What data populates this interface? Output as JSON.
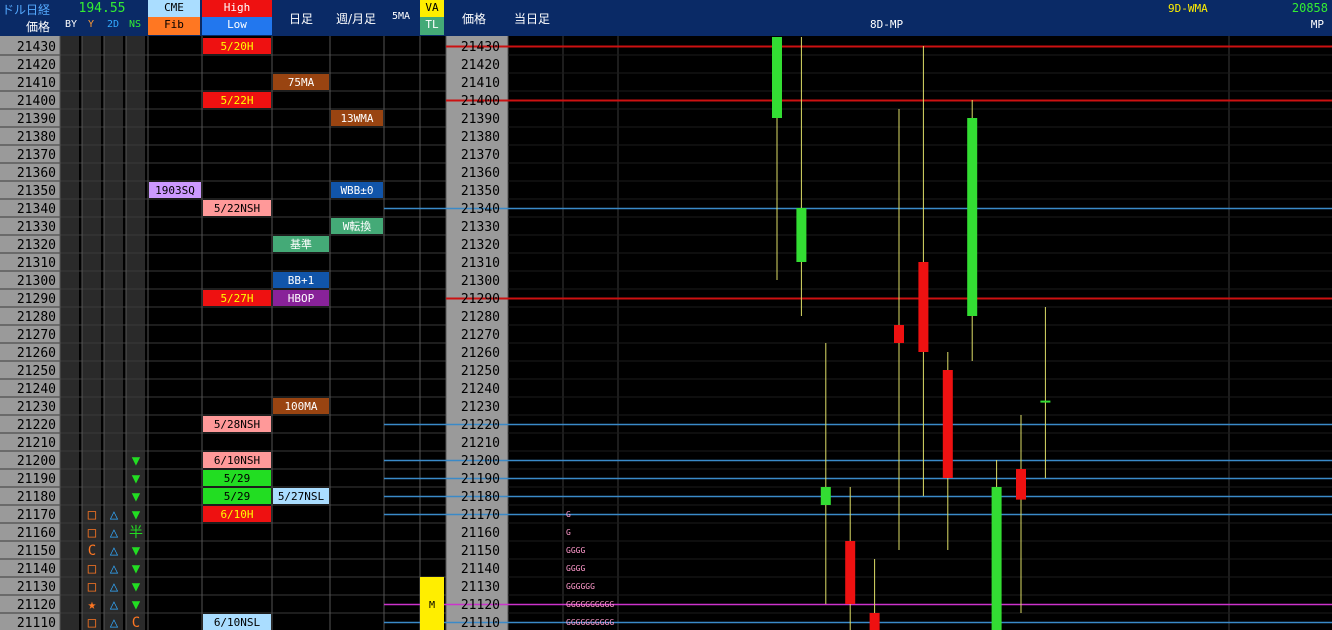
{
  "header": {
    "pair_title": "ドル日経",
    "price_label": "価格",
    "value": "194.55",
    "cme": "CME",
    "fib": "Fib",
    "high": "High",
    "low": "Low",
    "col_by": "BY",
    "col_y": "Y",
    "col_2d": "2D",
    "col_ns": "NS",
    "daily": "日足",
    "weekly_monthly": "週/月足",
    "ma5": "5MA",
    "va": "VA",
    "tl": "TL",
    "price_label2": "価格",
    "today_bar": "当日足",
    "mp8d": "8D-MP",
    "wma9d": "9D-WMA",
    "wma_value": "20858",
    "mp": "MP"
  },
  "colors": {
    "header_bg": "#0a2a66",
    "price_col_bg": "#9a9a9a",
    "up_candle": "#33dd33",
    "down_candle": "#ee1111",
    "red_line": "#cc1111",
    "blue_line": "#3a8ac8",
    "magenta_line": "#cc33cc"
  },
  "chart_data": {
    "type": "candlestick",
    "title": "ドル日経",
    "y_range": [
      21105,
      21435
    ],
    "prices": [
      21430,
      21420,
      21410,
      21400,
      21390,
      21380,
      21370,
      21360,
      21350,
      21340,
      21330,
      21320,
      21310,
      21300,
      21290,
      21280,
      21270,
      21260,
      21250,
      21240,
      21230,
      21220,
      21210,
      21200,
      21190,
      21180,
      21170,
      21160,
      21150,
      21140,
      21130,
      21120,
      21110
    ],
    "candles": [
      {
        "open": 21390,
        "close": 21435,
        "high": 21435,
        "low": 21300
      },
      {
        "open": 21310,
        "close": 21340,
        "high": 21435,
        "low": 21280
      },
      {
        "open": 21175,
        "close": 21185,
        "high": 21265,
        "low": 21120
      },
      {
        "open": 21155,
        "close": 21120,
        "high": 21185,
        "low": 21100
      },
      {
        "open": 21115,
        "close": 21105,
        "high": 21145,
        "low": 21100
      },
      {
        "open": 21275,
        "close": 21265,
        "high": 21395,
        "low": 21150
      },
      {
        "open": 21310,
        "close": 21260,
        "high": 21430,
        "low": 21180
      },
      {
        "open": 21250,
        "close": 21190,
        "high": 21260,
        "low": 21150
      },
      {
        "open": 21280,
        "close": 21390,
        "high": 21400,
        "low": 21255
      },
      {
        "open": 21100,
        "close": 21185,
        "high": 21200,
        "low": 21100
      },
      {
        "open": 21195,
        "close": 21178,
        "high": 21225,
        "low": 21115
      },
      {
        "open": 21233,
        "close": 21233,
        "high": 21285,
        "low": 21190
      }
    ],
    "horizontal_lines": [
      {
        "price": 21430,
        "color": "red"
      },
      {
        "price": 21400,
        "color": "red"
      },
      {
        "price": 21290,
        "color": "red"
      },
      {
        "price": 21340,
        "color": "blue"
      },
      {
        "price": 21220,
        "color": "blue"
      },
      {
        "price": 21200,
        "color": "blue"
      },
      {
        "price": 21190,
        "color": "blue"
      },
      {
        "price": 21180,
        "color": "blue"
      },
      {
        "price": 21170,
        "color": "blue"
      },
      {
        "price": 21120,
        "color": "magenta"
      },
      {
        "price": 21110,
        "color": "blue"
      }
    ],
    "market_profile": [
      {
        "price": 21170,
        "text": "G"
      },
      {
        "price": 21160,
        "text": "G"
      },
      {
        "price": 21150,
        "text": "GGGG"
      },
      {
        "price": 21140,
        "text": "GGGG"
      },
      {
        "price": 21130,
        "text": "GGGGGG"
      },
      {
        "price": 21120,
        "text": "GGGGGGGGGG"
      },
      {
        "price": 21110,
        "text": "GGGGGGGGGG"
      }
    ]
  },
  "cme_labels": [
    {
      "price": 21350,
      "text": "1903SQ",
      "color": "#cc99ff"
    }
  ],
  "highlow_labels": [
    {
      "price": 21430,
      "text": "5/20H",
      "color": "#ee1111",
      "text_color": "#ffff00"
    },
    {
      "price": 21400,
      "text": "5/22H",
      "color": "#ee1111",
      "text_color": "#ffff00"
    },
    {
      "price": 21340,
      "text": "5/22NSH",
      "color": "#ff9999",
      "text_color": "#000"
    },
    {
      "price": 21290,
      "text": "5/27H",
      "color": "#ee1111",
      "text_color": "#ffff00"
    },
    {
      "price": 21220,
      "text": "5/28NSH",
      "color": "#ff9999",
      "text_color": "#000"
    },
    {
      "price": 21200,
      "text": "6/10NSH",
      "color": "#ff9999",
      "text_color": "#000"
    },
    {
      "price": 21190,
      "text": "5/29",
      "color": "#22dd22",
      "text_color": "#000"
    },
    {
      "price": 21180,
      "text": "5/29",
      "color": "#22dd22",
      "text_color": "#000"
    },
    {
      "price": 21170,
      "text": "6/10H",
      "color": "#ee1111",
      "text_color": "#ffff00"
    },
    {
      "price": 21110,
      "text": "6/10NSL",
      "color": "#aaddff",
      "text_color": "#000"
    }
  ],
  "daily_labels": [
    {
      "price": 21410,
      "text": "75MA",
      "color": "#994411",
      "text_color": "#fff"
    },
    {
      "price": 21320,
      "text": "基準",
      "color": "#44aa77",
      "text_color": "#fff"
    },
    {
      "price": 21300,
      "text": "BB+1",
      "color": "#1155aa",
      "text_color": "#fff"
    },
    {
      "price": 21290,
      "text": "HBOP",
      "color": "#882299",
      "text_color": "#fff"
    },
    {
      "price": 21230,
      "text": "100MA",
      "color": "#994411",
      "text_color": "#fff"
    },
    {
      "price": 21180,
      "text": "5/27NSL",
      "color": "#aaddff",
      "text_color": "#000"
    }
  ],
  "weekly_labels": [
    {
      "price": 21390,
      "text": "13WMA",
      "color": "#994411",
      "text_color": "#fff"
    },
    {
      "price": 21350,
      "text": "WBB±0",
      "color": "#1155aa",
      "text_color": "#fff"
    },
    {
      "price": 21330,
      "text": "W転換",
      "color": "#44aa77",
      "text_color": "#fff"
    }
  ],
  "va_marks": [
    {
      "price": 21130,
      "text": ""
    },
    {
      "price": 21120,
      "text": "M"
    },
    {
      "price": 21110,
      "text": ""
    }
  ],
  "signal_rows": [
    {
      "price": 21200,
      "by": "",
      "y": "",
      "d2": "",
      "ns": "▼"
    },
    {
      "price": 21190,
      "by": "",
      "y": "",
      "d2": "",
      "ns": "▼"
    },
    {
      "price": 21180,
      "by": "",
      "y": "",
      "d2": "",
      "ns": "▼"
    },
    {
      "price": 21170,
      "by": "□",
      "y": "△",
      "d2": "",
      "ns": "▼"
    },
    {
      "price": 21160,
      "by": "□",
      "y": "△",
      "d2": "",
      "ns": "半"
    },
    {
      "price": 21150,
      "by": "C",
      "y": "△",
      "d2": "",
      "ns": "▼"
    },
    {
      "price": 21140,
      "by": "□",
      "y": "△",
      "d2": "",
      "ns": "▼"
    },
    {
      "price": 21130,
      "by": "□",
      "y": "△",
      "d2": "",
      "ns": "▼"
    },
    {
      "price": 21120,
      "by": "★",
      "y": "△",
      "d2": "",
      "ns": "▼"
    },
    {
      "price": 21110,
      "by": "□",
      "y": "△",
      "d2": "",
      "ns": "C"
    }
  ]
}
